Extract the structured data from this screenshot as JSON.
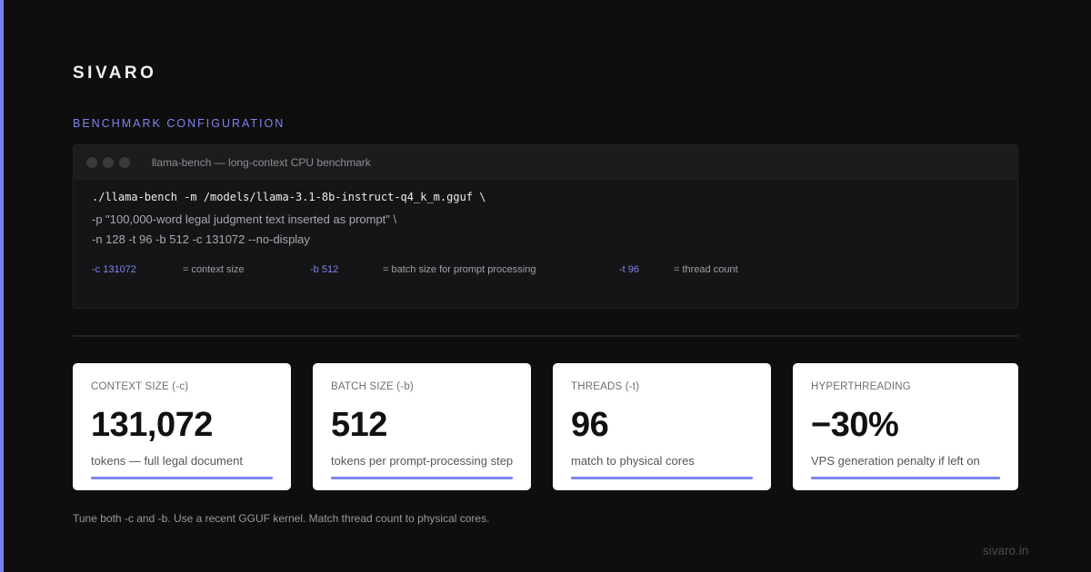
{
  "brand": "SIVARO",
  "section_title": "BENCHMARK CONFIGURATION",
  "terminal": {
    "title": "llama-bench — long-context CPU benchmark",
    "lines": [
      "./llama-bench -m /models/llama-3.1-8b-instruct-q4_k_m.gguf \\",
      "-p \"100,000-word legal judgment text inserted as prompt\" \\",
      "-n 128 -t 96 -b 512 -c 131072 --no-display"
    ],
    "params": [
      {
        "flag": "-c 131072",
        "desc": "= context size"
      },
      {
        "flag": "-b 512",
        "desc": "= batch size for prompt processing"
      },
      {
        "flag": "-t 96",
        "desc": "= thread count"
      }
    ]
  },
  "cards": [
    {
      "label": "CONTEXT SIZE (-c)",
      "value": "131,072",
      "sub": "tokens — full legal document"
    },
    {
      "label": "BATCH SIZE (-b)",
      "value": "512",
      "sub": "tokens per prompt-processing step"
    },
    {
      "label": "THREADS (-t)",
      "value": "96",
      "sub": "match to physical cores"
    },
    {
      "label": "HYPERTHREADING",
      "value": "−30%",
      "sub": "VPS generation penalty if left on"
    }
  ],
  "footnote": "Tune both -c and -b. Use a recent GGUF kernel. Match thread count to physical cores.",
  "site": "sivaro.in",
  "colors": {
    "accent": "#7f85ef",
    "background": "#0e0e0e",
    "card": "#ffffff"
  }
}
